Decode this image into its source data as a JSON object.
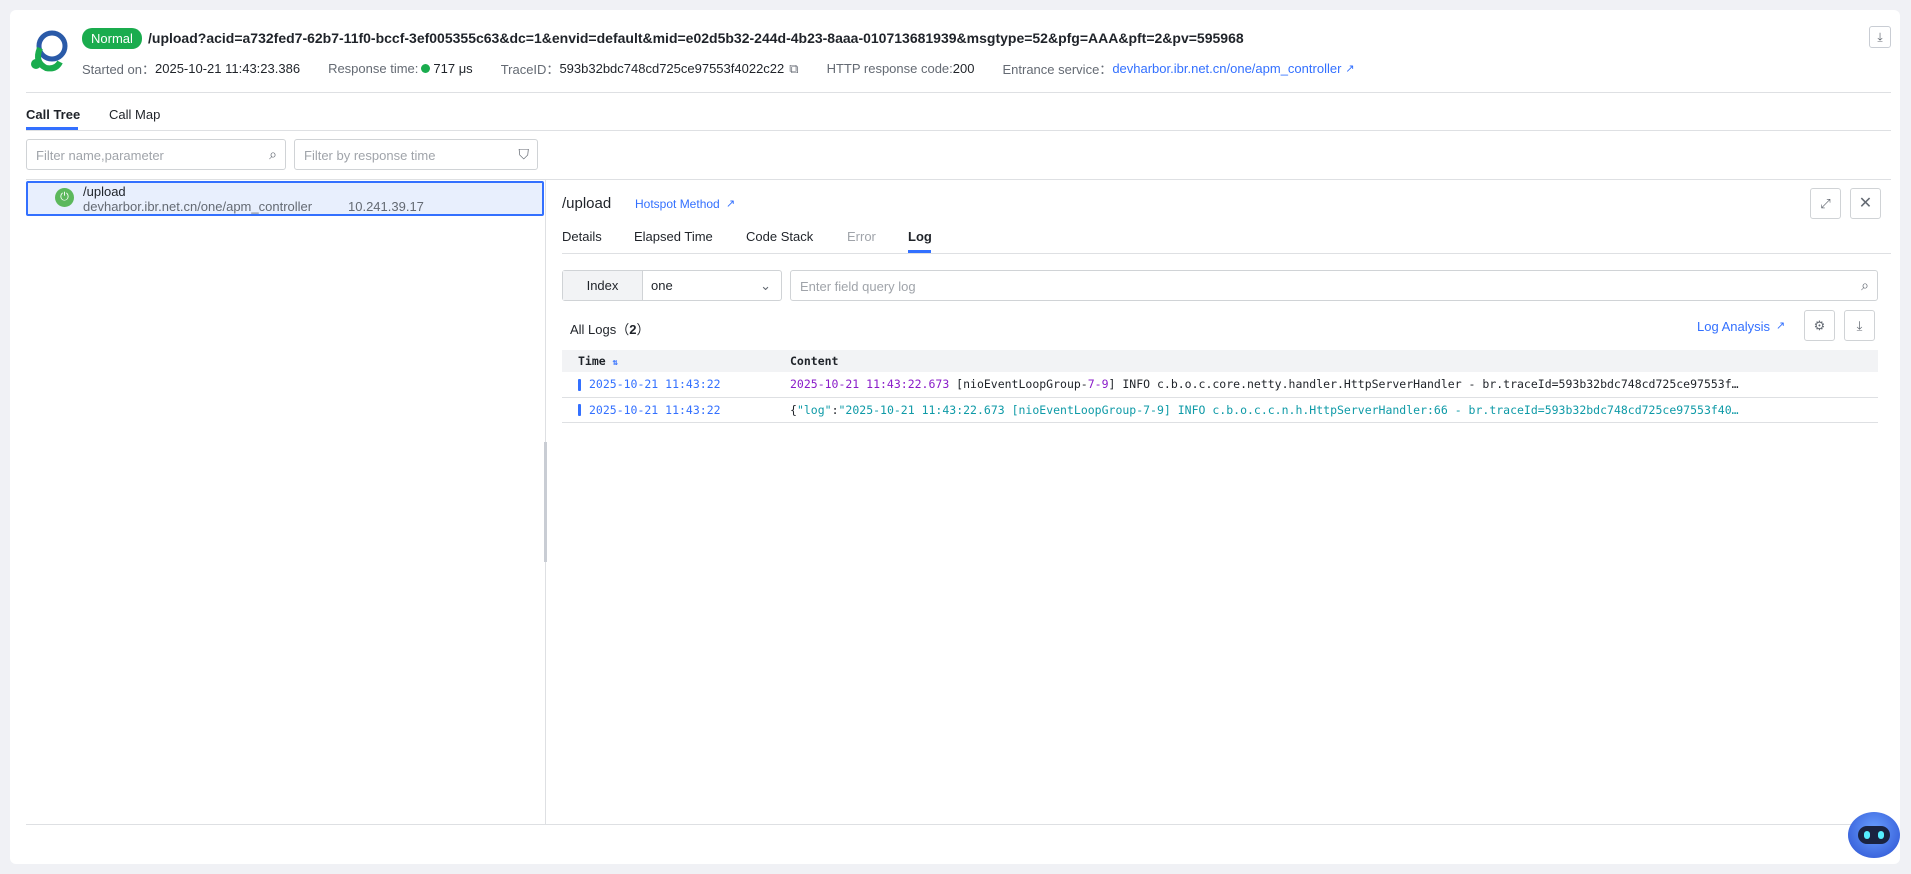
{
  "header": {
    "status": "Normal",
    "url": "/upload?acid=a732fed7-62b7-11f0-bccf-3ef005355c63&dc=1&envid=default&mid=e02d5b32-244d-4b23-8aaa-010713681939&msgtype=52&pfg=AAA&pft=2&pv=595968",
    "started_label": "Started on：",
    "started": "2025-10-21 11:43:23.386",
    "response_label": "Response time:",
    "response": "717 μs",
    "trace_label": "TraceID：",
    "trace": "593b32bdc748cd725ce97553f4022c22",
    "http_label": "HTTP response code:",
    "http": "200",
    "entrance_label": "Entrance service：",
    "entrance": "devharbor.ibr.net.cn/one/apm_controller",
    "status_color": "#1aac4e"
  },
  "tabs": [
    "Call Tree",
    "Call Map"
  ],
  "filters": {
    "name_placeholder": "Filter name,parameter",
    "time_placeholder": "Filter by response time"
  },
  "tree": {
    "name": "/upload",
    "service": "devharbor.ibr.net.cn/one/apm_controller",
    "ip": "10.241.39.17"
  },
  "detail": {
    "title": "/upload",
    "hotspot": "Hotspot Method",
    "tabs": [
      "Details",
      "Elapsed Time",
      "Code Stack",
      "Error",
      "Log"
    ],
    "index_label": "Index",
    "index_value": "one",
    "query_placeholder": "Enter field query log",
    "all_logs": "All Logs（",
    "count": "2",
    "all_logs_end": "）",
    "log_analysis": "Log Analysis",
    "columns": [
      "Time",
      "Content"
    ],
    "rows": [
      {
        "time": "2025-10-21 11:43:22",
        "ts": "2025-10-21 11:43:22.673",
        "a": " [nioEventLoopGroup-",
        "b": "7-9",
        "c": "] INFO c.b.o.c.core.netty.handler.HttpServerHandler - br.traceId=593b32bdc748cd725ce97553f…"
      },
      {
        "time": "2025-10-21 11:43:22",
        "pre": "{",
        "key": "\"log\"",
        "colon": ":",
        "val": "\"2025-10-21 11:43:22.673 [nioEventLoopGroup-7-9] INFO c.b.o.c.c.n.h.HttpServerHandler:66 - br.traceId=593b32bdc748cd725ce97553f40…"
      }
    ]
  }
}
